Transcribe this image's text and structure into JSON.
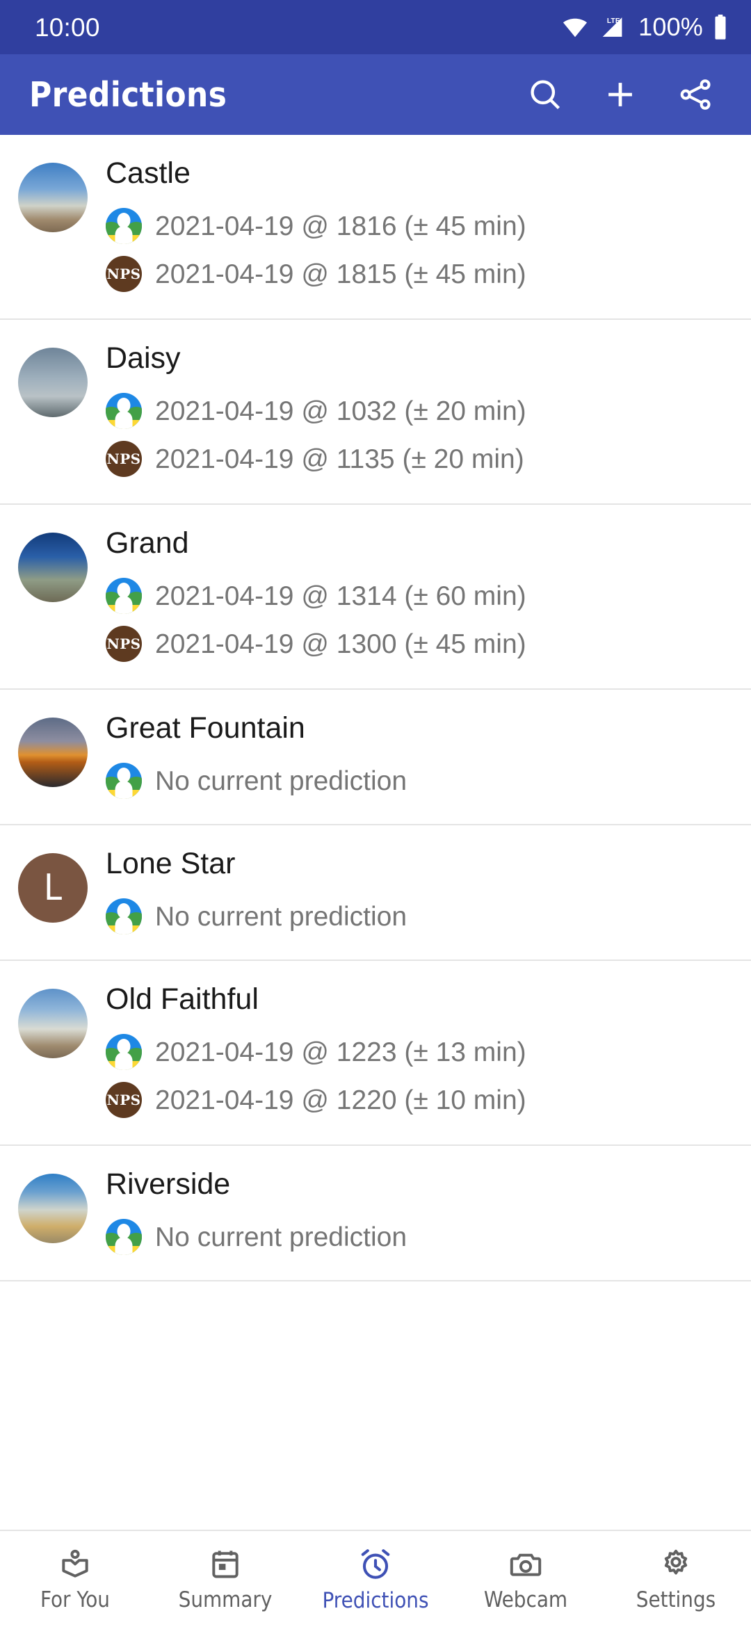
{
  "status_bar": {
    "time": "10:00",
    "battery_percent": "100%",
    "network_type": "LTE",
    "icons": [
      "wifi-icon",
      "lte-signal-icon",
      "battery-icon"
    ],
    "background": "#303F9F"
  },
  "app_bar": {
    "title": "Predictions",
    "background": "#3F51B5",
    "actions": [
      {
        "name": "search-button",
        "icon": "search-icon"
      },
      {
        "name": "add-button",
        "icon": "plus-icon"
      },
      {
        "name": "share-button",
        "icon": "share-icon"
      }
    ]
  },
  "list": {
    "geysers": [
      {
        "name": "Castle",
        "thumb": "castle-geyser-photo",
        "predictions": [
          {
            "source": "geysertimes",
            "icon": "geysertimes-icon",
            "text": "2021-04-19 @ 1816 (± 45 min)"
          },
          {
            "source": "nps",
            "icon": "nps-icon",
            "label": "NPS",
            "text": "2021-04-19 @ 1815 (± 45 min)"
          }
        ]
      },
      {
        "name": "Daisy",
        "thumb": "daisy-geyser-photo",
        "predictions": [
          {
            "source": "geysertimes",
            "icon": "geysertimes-icon",
            "text": "2021-04-19 @ 1032 (± 20 min)"
          },
          {
            "source": "nps",
            "icon": "nps-icon",
            "label": "NPS",
            "text": "2021-04-19 @ 1135 (± 20 min)"
          }
        ]
      },
      {
        "name": "Grand",
        "thumb": "grand-geyser-photo",
        "predictions": [
          {
            "source": "geysertimes",
            "icon": "geysertimes-icon",
            "text": "2021-04-19 @ 1314 (± 60 min)"
          },
          {
            "source": "nps",
            "icon": "nps-icon",
            "label": "NPS",
            "text": "2021-04-19 @ 1300 (± 45 min)"
          }
        ]
      },
      {
        "name": "Great Fountain",
        "thumb": "great-fountain-geyser-photo",
        "predictions": [
          {
            "source": "geysertimes",
            "icon": "geysertimes-icon",
            "text": "No current prediction"
          }
        ]
      },
      {
        "name": "Lone Star",
        "thumb": "letter-avatar",
        "thumb_letter": "L",
        "thumb_color": "#7A5541",
        "predictions": [
          {
            "source": "geysertimes",
            "icon": "geysertimes-icon",
            "text": "No current prediction"
          }
        ]
      },
      {
        "name": "Old Faithful",
        "thumb": "old-faithful-geyser-photo",
        "predictions": [
          {
            "source": "geysertimes",
            "icon": "geysertimes-icon",
            "text": "2021-04-19 @ 1223 (± 13 min)"
          },
          {
            "source": "nps",
            "icon": "nps-icon",
            "label": "NPS",
            "text": "2021-04-19 @ 1220 (± 10 min)"
          }
        ]
      },
      {
        "name": "Riverside",
        "thumb": "riverside-geyser-photo",
        "predictions": [
          {
            "source": "geysertimes",
            "icon": "geysertimes-icon",
            "text": "No current prediction"
          }
        ]
      }
    ]
  },
  "bottom_nav": {
    "active_color": "#3F51B5",
    "inactive_color": "#616161",
    "items": [
      {
        "label": "For You",
        "icon": "local-library-icon",
        "active": false
      },
      {
        "label": "Summary",
        "icon": "calendar-icon",
        "active": false
      },
      {
        "label": "Predictions",
        "icon": "alarm-clock-icon",
        "active": true
      },
      {
        "label": "Webcam",
        "icon": "camera-icon",
        "active": false
      },
      {
        "label": "Settings",
        "icon": "gear-icon",
        "active": false
      }
    ]
  }
}
